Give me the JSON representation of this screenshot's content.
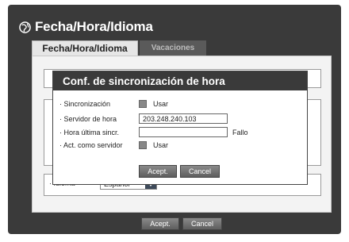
{
  "window": {
    "title": "Fecha/Hora/Idioma"
  },
  "tabs": [
    {
      "label": "Fecha/Hora/Idioma",
      "active": true
    },
    {
      "label": "Vacaciones",
      "active": false
    }
  ],
  "main": {
    "language_label": "· Idioma",
    "language_value": "Español"
  },
  "footer": {
    "accept_label": "Acept.",
    "cancel_label": "Cancel"
  },
  "dialog": {
    "title": "Conf. de sincronización de hora",
    "rows": [
      {
        "label": "· Sincronización",
        "checkbox_text": "Usar"
      },
      {
        "label": "· Servidor de hora",
        "value": "203.248.240.103"
      },
      {
        "label": "· Hora  última sincr.",
        "value": "",
        "status": "Fallo"
      },
      {
        "label": "· Act. como servidor",
        "checkbox_text": "Usar"
      }
    ],
    "accept_label": "Acept.",
    "cancel_label": "Cancel"
  },
  "colors": {
    "dark_bg": "#3a3a3a",
    "panel_bg": "#f3f3f3",
    "accent_dropdown": "#3e4a5a"
  }
}
